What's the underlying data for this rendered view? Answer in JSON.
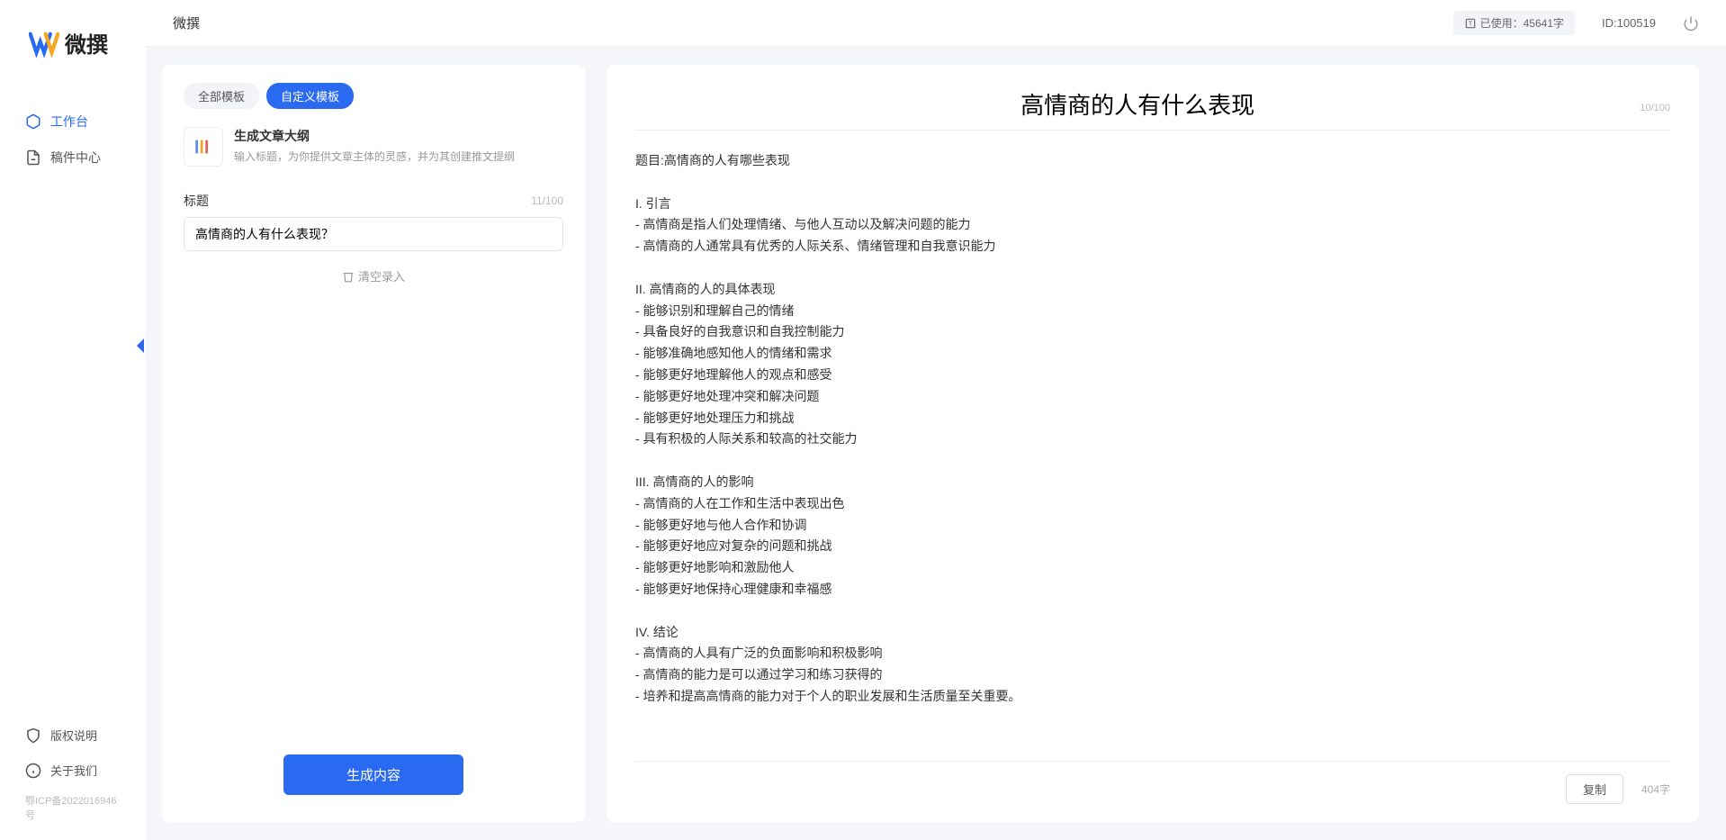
{
  "app_name": "微撰",
  "topbar": {
    "title": "微撰",
    "usage_label": "已使用：45641字",
    "user_id": "ID:100519"
  },
  "sidebar": {
    "items": [
      {
        "label": "工作台",
        "icon": "cube-icon",
        "active": true
      },
      {
        "label": "稿件中心",
        "icon": "doc-icon",
        "active": false
      }
    ],
    "bottom": [
      {
        "label": "版权说明",
        "icon": "shield-icon"
      },
      {
        "label": "关于我们",
        "icon": "info-icon"
      }
    ],
    "icp": "鄂ICP备2022016946号"
  },
  "left_panel": {
    "tabs": [
      {
        "label": "全部模板",
        "active": false
      },
      {
        "label": "自定义模板",
        "active": true
      }
    ],
    "template": {
      "title": "生成文章大纲",
      "desc": "输入标题，为你提供文章主体的灵感，并为其创建推文提纲"
    },
    "field_label": "标题",
    "title_char_count": "11/100",
    "title_value": "高情商的人有什么表现？",
    "clear_label": "清空录入",
    "generate_label": "生成内容"
  },
  "right_panel": {
    "title": "高情商的人有什么表现",
    "title_char_count": "10/100",
    "body": "题目:高情商的人有哪些表现\n\nI. 引言\n- 高情商是指人们处理情绪、与他人互动以及解决问题的能力\n- 高情商的人通常具有优秀的人际关系、情绪管理和自我意识能力\n\nII. 高情商的人的具体表现\n- 能够识别和理解自己的情绪\n- 具备良好的自我意识和自我控制能力\n- 能够准确地感知他人的情绪和需求\n- 能够更好地理解他人的观点和感受\n- 能够更好地处理冲突和解决问题\n- 能够更好地处理压力和挑战\n- 具有积极的人际关系和较高的社交能力\n\nIII. 高情商的人的影响\n- 高情商的人在工作和生活中表现出色\n- 能够更好地与他人合作和协调\n- 能够更好地应对复杂的问题和挑战\n- 能够更好地影响和激励他人\n- 能够更好地保持心理健康和幸福感\n\nIV. 结论\n- 高情商的人具有广泛的负面影响和积极影响\n- 高情商的能力是可以通过学习和练习获得的\n- 培养和提高高情商的能力对于个人的职业发展和生活质量至关重要。",
    "copy_label": "复制",
    "word_count": "404字"
  }
}
